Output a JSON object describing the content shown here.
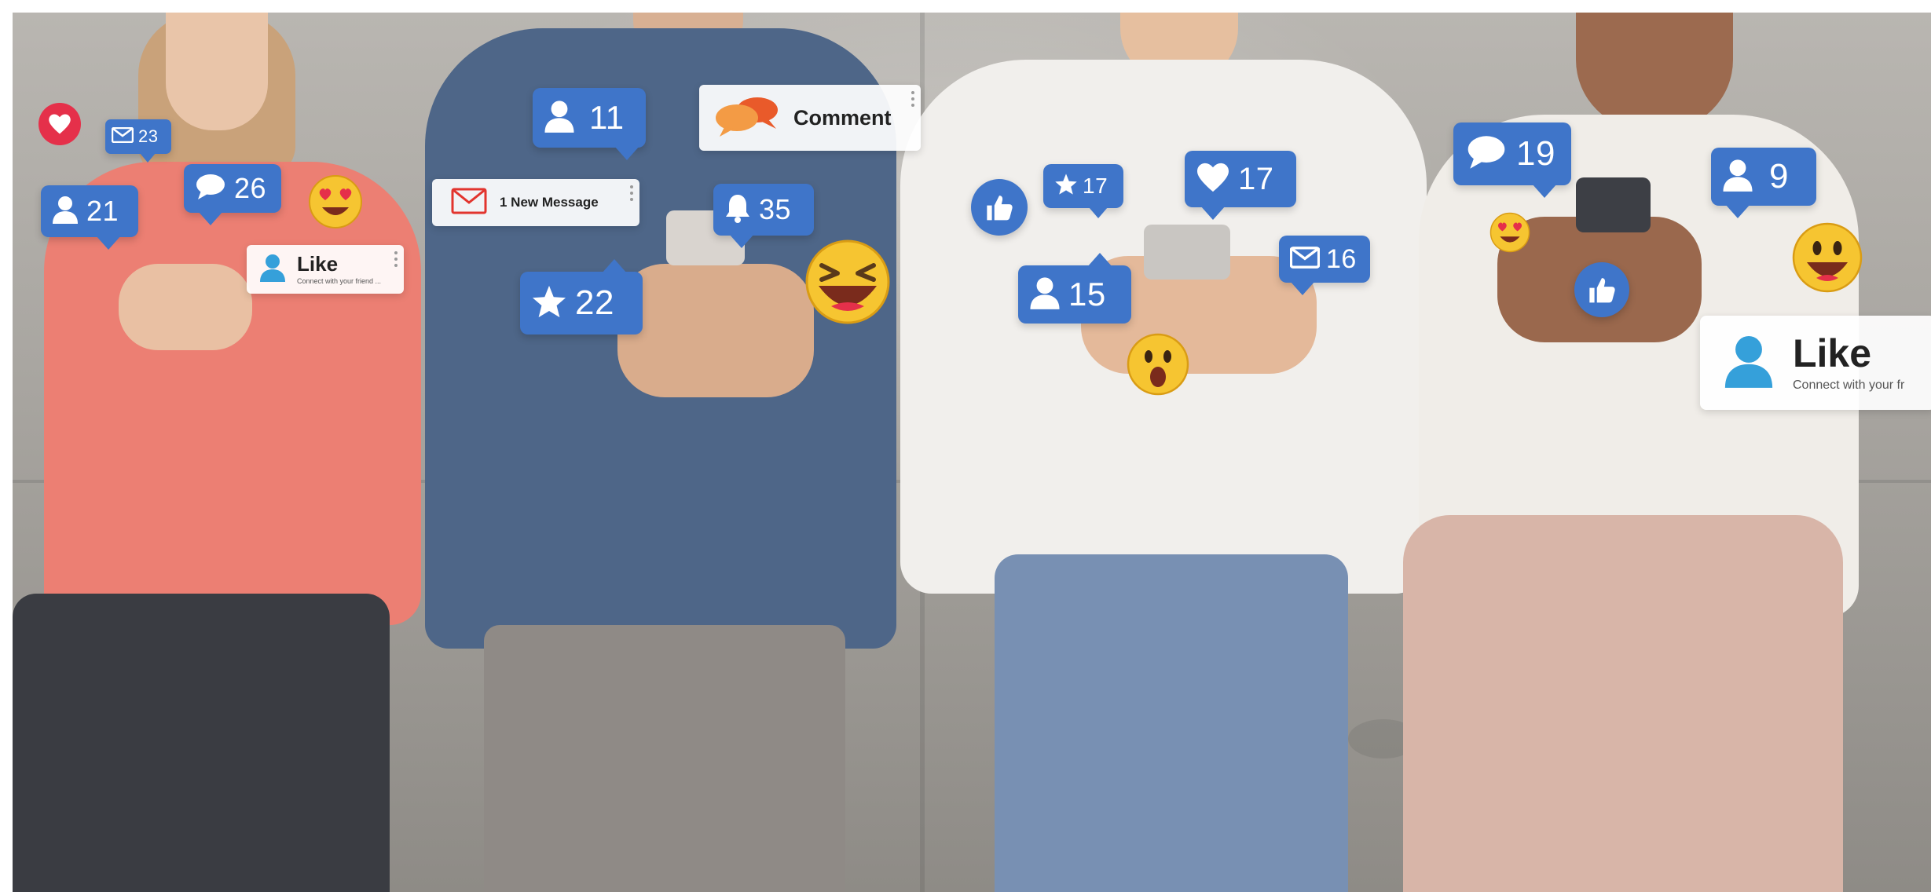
{
  "scene": {
    "description_icons": [
      "like-icon",
      "heart-icon",
      "mail-icon",
      "user-icon",
      "comment-icon",
      "star-icon",
      "bell-icon",
      "thumbs-up-icon"
    ]
  },
  "colors": {
    "bubble_blue": "#3f75c9",
    "heart_red": "#e5304a",
    "comment_orange": "#f07b3f",
    "emoji_yellow": "#f6c531"
  },
  "notifications": {
    "mail_23": "23",
    "user_21": "21",
    "comment_26": "26",
    "user_11": "11",
    "bell_35": "35",
    "star_22": "22",
    "star_17": "17",
    "heart_17": "17",
    "user_15": "15",
    "mail_16": "16",
    "comment_19": "19",
    "user_9": "9"
  },
  "cards": {
    "comment_label": "Comment",
    "message_label": "1 New Message",
    "like_small_label": "Like",
    "like_small_sub": "Connect with your friend ...",
    "like_large_label": "Like",
    "like_large_sub": "Connect with your fr"
  }
}
